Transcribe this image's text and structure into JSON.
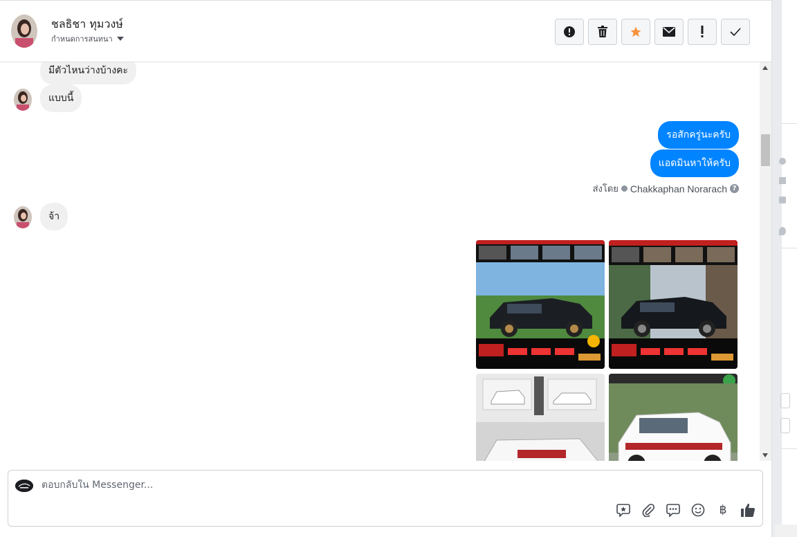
{
  "header": {
    "contact_name": "ชลธิชา ทุมวงษ์",
    "assign_label": "กำหนดการสนทนา"
  },
  "toolbar": {
    "items": [
      "spam",
      "delete",
      "star",
      "mark-unread",
      "follow-up",
      "done"
    ]
  },
  "messages": {
    "in_1": "มีตัวไหนว่างบ้างคะ",
    "in_2": "แบบนี้",
    "out_1": "รอสักครู่นะครับ",
    "out_2": "แอดมินหาให้ครับ",
    "sent_by_label": "ส่งโดย",
    "sent_by_agent": "Chakkaphan Norarach",
    "in_3": "จ้า"
  },
  "composer": {
    "placeholder": "ตอบกลับใน Messenger...",
    "currency_symbol": "฿"
  },
  "colors": {
    "outgoing_bubble": "#0084ff",
    "incoming_bubble": "#f1f0f0",
    "star_accent": "#f7923b"
  }
}
